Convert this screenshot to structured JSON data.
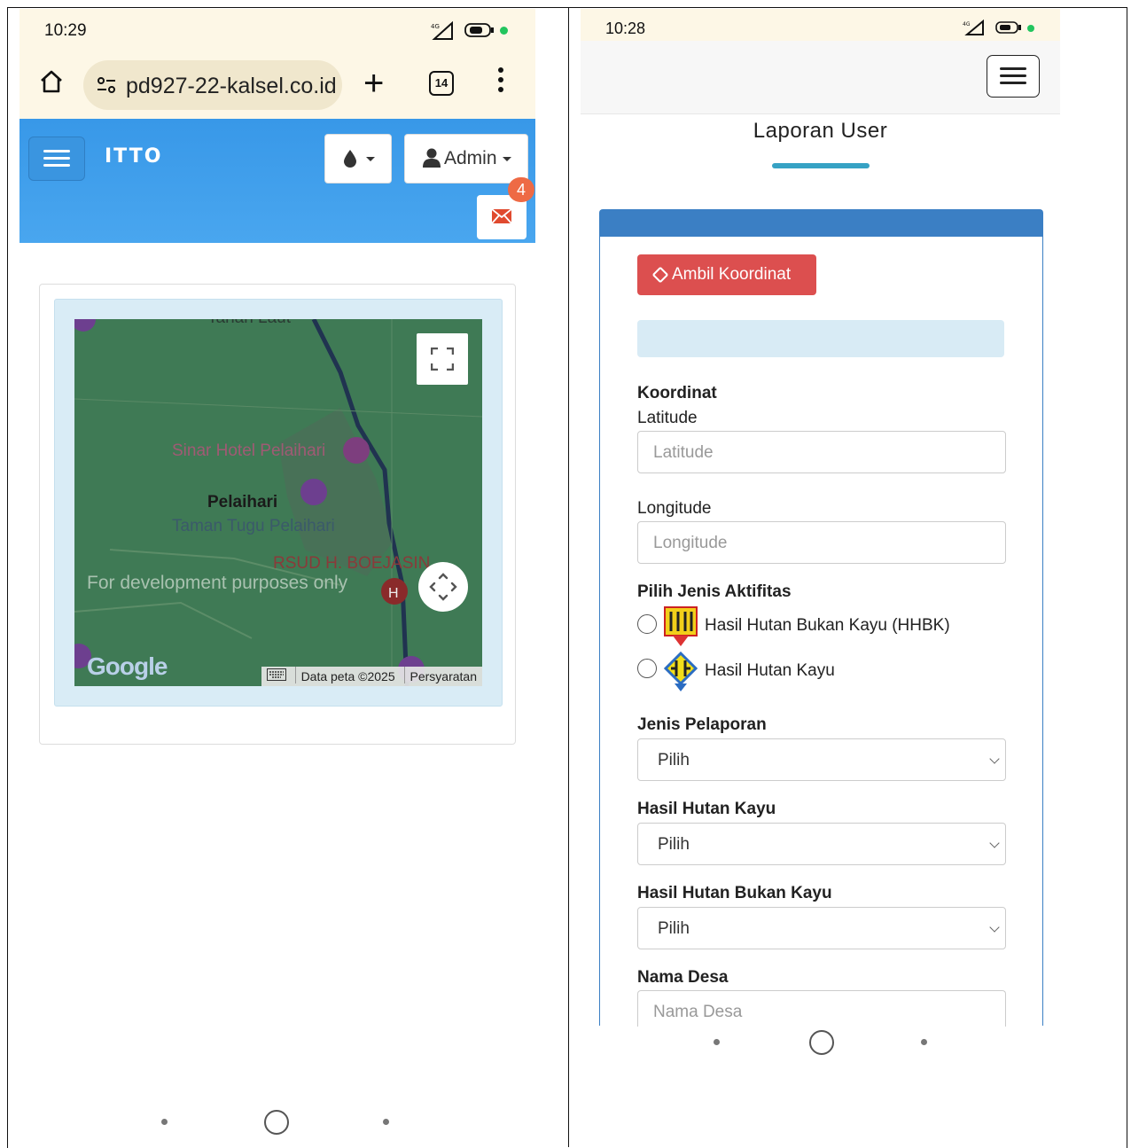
{
  "left": {
    "status_time": "10:29",
    "url": "pd927-22-kalsel.co.id",
    "tab_count": "14",
    "brand": "ITTO",
    "admin_label": "Admin",
    "mail_badge": "4",
    "map": {
      "labels": {
        "top": "Tanah Laut",
        "hotel": "Sinar Hotel Pelaihari",
        "city": "Pelaihari",
        "park": "Taman Tugu Pelaihari",
        "hospital": "RSUD H. BOEJASIN",
        "dev": "For development purposes only",
        "google": "Google"
      },
      "attribution": {
        "data": "Data peta ©2025",
        "terms": "Persyaratan"
      }
    }
  },
  "right": {
    "status_time": "10:28",
    "page_title": "Laporan User",
    "ambil_button": "Ambil Koordinat",
    "koordinat_heading": "Koordinat",
    "latitude_label": "Latitude",
    "latitude_placeholder": "Latitude",
    "longitude_label": "Longitude",
    "longitude_placeholder": "Longitude",
    "aktifitas_heading": "Pilih Jenis Aktifitas",
    "radio_hhbk": "Hasil Hutan Bukan Kayu (HHBK)",
    "radio_hhk": "Hasil Hutan Kayu",
    "jenis_pelaporan_label": "Jenis Pelaporan",
    "jenis_pelaporan_value": "Pilih",
    "hasil_kayu_label": "Hasil Hutan Kayu",
    "hasil_kayu_value": "Pilih",
    "hasil_bukan_kayu_label": "Hasil Hutan Bukan Kayu",
    "hasil_bukan_kayu_value": "Pilih",
    "nama_desa_label": "Nama Desa",
    "nama_desa_placeholder": "Nama Desa"
  },
  "colors": {
    "navbar_blue": "#3898e8",
    "danger_red": "#dc4f4f",
    "card_blue": "#3b7fc4",
    "accent_teal": "#36a2c4",
    "map_green": "#3f7a55"
  }
}
